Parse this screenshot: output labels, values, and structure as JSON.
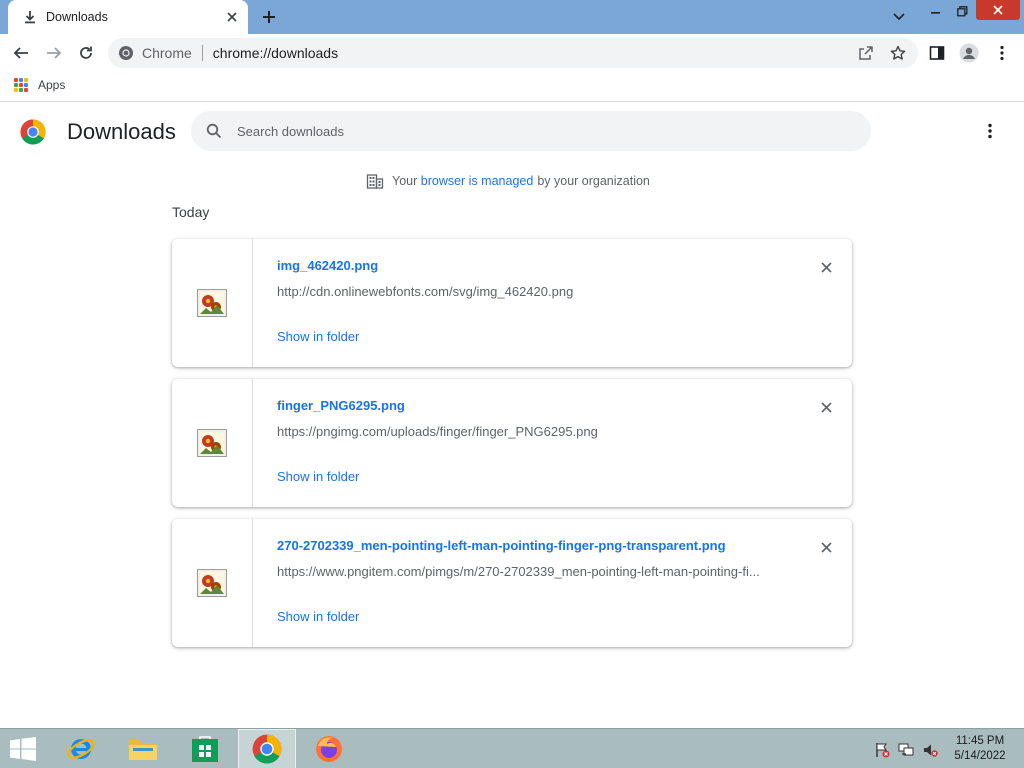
{
  "tab": {
    "title": "Downloads"
  },
  "omnibox": {
    "chip": "Chrome",
    "url": "chrome://downloads"
  },
  "bookmarks": {
    "apps_label": "Apps"
  },
  "header": {
    "title": "Downloads",
    "search_placeholder": "Search downloads"
  },
  "managed": {
    "prefix": "Your",
    "link": "browser is managed",
    "suffix": "by your organization"
  },
  "section": {
    "date": "Today"
  },
  "downloads": [
    {
      "name": "img_462420.png",
      "url": "http://cdn.onlinewebfonts.com/svg/img_462420.png",
      "action": "Show in folder"
    },
    {
      "name": "finger_PNG6295.png",
      "url": "https://pngimg.com/uploads/finger/finger_PNG6295.png",
      "action": "Show in folder"
    },
    {
      "name": "270-2702339_men-pointing-left-man-pointing-finger-png-transparent.png",
      "url": "https://www.pngitem.com/pimgs/m/270-2702339_men-pointing-left-man-pointing-fi...",
      "action": "Show in folder"
    }
  ],
  "clock": {
    "time": "11:45 PM",
    "date": "5/14/2022"
  },
  "colors": {
    "accent": "#1a73e8",
    "tabstrip": "#7aa7d6",
    "taskbar": "#a9bdbf",
    "close": "#c7392b"
  },
  "icons": {
    "tab": "download-icon",
    "back": "back-arrow-icon",
    "forward": "forward-arrow-icon",
    "reload": "reload-icon",
    "share": "share-icon",
    "star": "bookmark-star-icon",
    "sidepanel": "side-panel-icon",
    "profile": "profile-icon",
    "menu": "kebab-menu-icon",
    "search": "search-icon",
    "managed": "building-icon",
    "file": "image-file-icon",
    "remove": "close-icon"
  }
}
